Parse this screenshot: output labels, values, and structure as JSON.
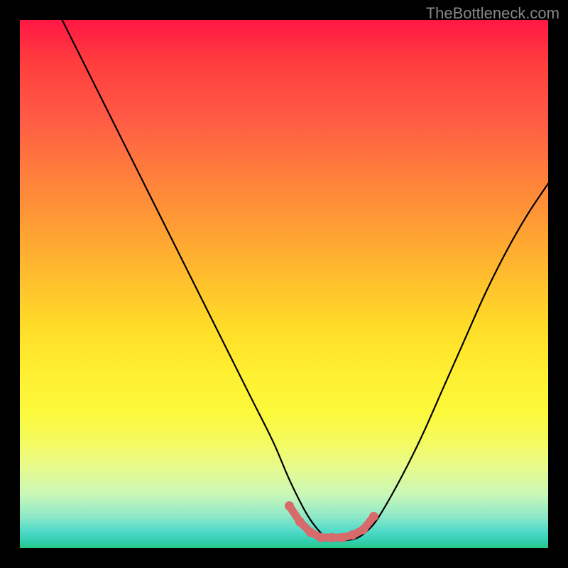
{
  "watermark": "TheBottleneck.com",
  "chart_data": {
    "type": "line",
    "title": "",
    "xlabel": "",
    "ylabel": "",
    "xlim": [
      0,
      100
    ],
    "ylim": [
      0,
      100
    ],
    "series": [
      {
        "name": "curve",
        "x": [
          8,
          12,
          16,
          20,
          24,
          28,
          32,
          36,
          40,
          44,
          48,
          51,
          54,
          56,
          58,
          60,
          62,
          64,
          66,
          68,
          72,
          76,
          80,
          84,
          88,
          92,
          96,
          100
        ],
        "values": [
          100,
          92,
          84,
          76,
          68,
          60,
          52,
          44,
          36,
          28,
          20,
          13,
          7,
          4,
          2,
          1.5,
          1.5,
          2,
          3.5,
          6,
          13,
          21,
          30,
          39,
          48,
          56,
          63,
          69
        ]
      }
    ],
    "highlight_region": {
      "name": "dotted-flat-region",
      "color": "#d76a6a",
      "x": [
        51,
        53,
        55,
        57,
        59,
        61,
        63,
        65,
        67
      ],
      "values": [
        8,
        5,
        3,
        2,
        2,
        2,
        2.5,
        3.5,
        6
      ]
    },
    "gradient_stops": [
      {
        "pos": 0,
        "color": "#ff1744"
      },
      {
        "pos": 18,
        "color": "#ff5945"
      },
      {
        "pos": 38,
        "color": "#ff9a35"
      },
      {
        "pos": 58,
        "color": "#ffdc28"
      },
      {
        "pos": 74,
        "color": "#fcf83a"
      },
      {
        "pos": 90,
        "color": "#c8f7b8"
      },
      {
        "pos": 100,
        "color": "#28c77e"
      }
    ]
  }
}
